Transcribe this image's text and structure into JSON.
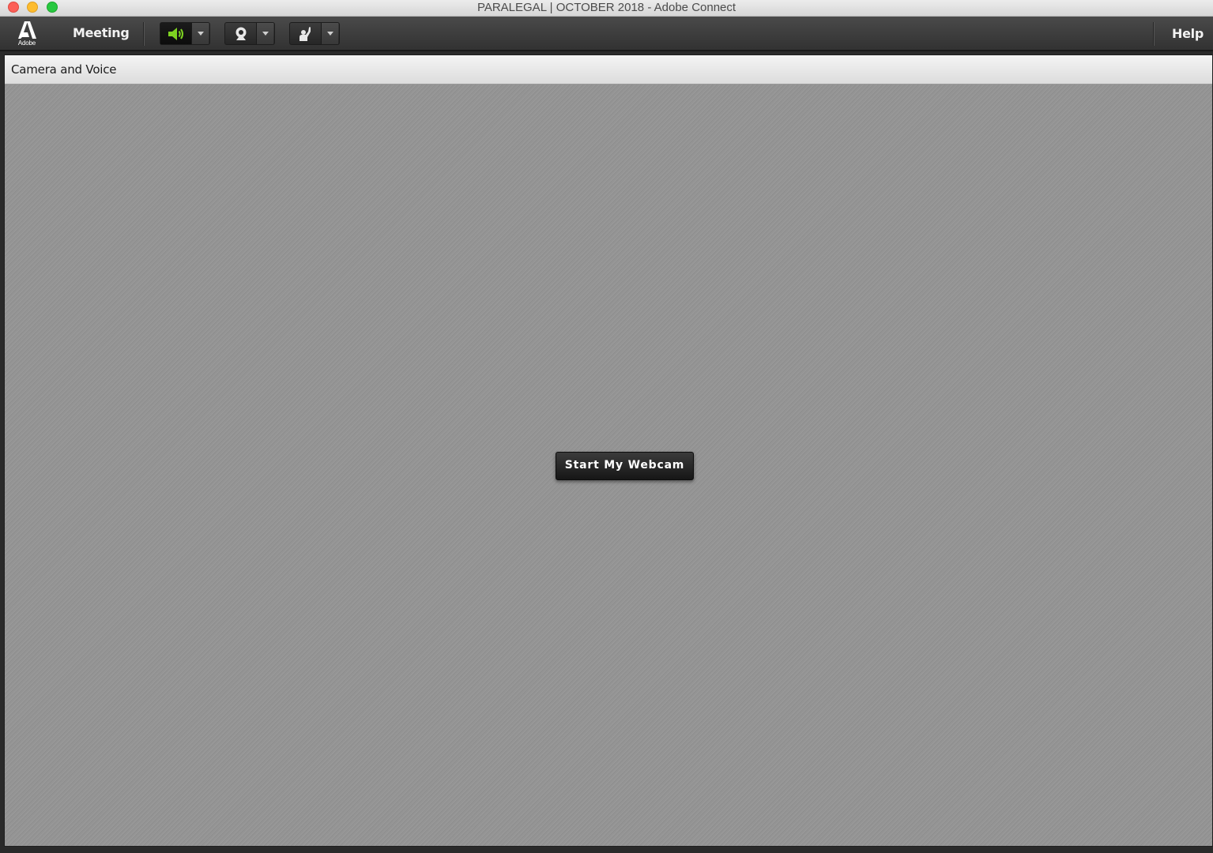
{
  "window": {
    "title": "PARALEGAL | OCTOBER 2018 - Adobe Connect"
  },
  "toolbar": {
    "logo_text": "Adobe",
    "menu_meeting": "Meeting",
    "speaker_icon": "speaker-icon",
    "speaker_active_color": "#7ed321",
    "webcam_icon": "webcam-icon",
    "raise_hand_icon": "raise-hand-icon",
    "help_label": "Help"
  },
  "pod": {
    "title": "Camera and Voice",
    "start_webcam_label": "Start My Webcam"
  },
  "colors": {
    "toolbar_bg": "#3c3c3c",
    "pod_bg": "#949494",
    "button_dark": "#1f1f1f"
  }
}
